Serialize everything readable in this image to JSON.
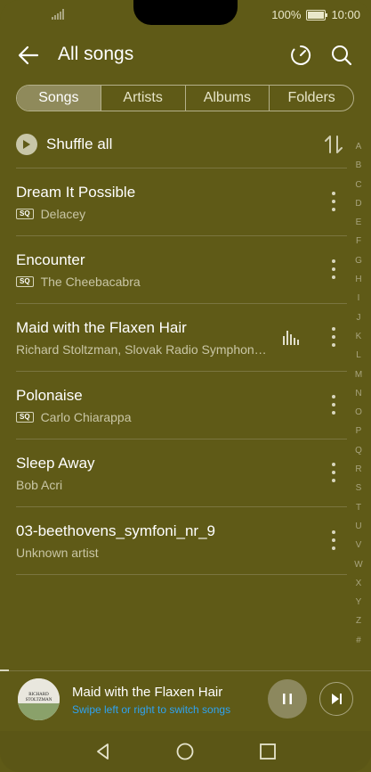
{
  "status": {
    "battery_text": "100%",
    "time": "10:00"
  },
  "header": {
    "title": "All songs",
    "icons": [
      "back-arrow-icon",
      "timer-icon",
      "search-icon"
    ]
  },
  "tabs": [
    {
      "label": "Songs",
      "active": true
    },
    {
      "label": "Artists",
      "active": false
    },
    {
      "label": "Albums",
      "active": false
    },
    {
      "label": "Folders",
      "active": false
    }
  ],
  "shuffle": {
    "label": "Shuffle all"
  },
  "songs": [
    {
      "title": "Dream It Possible",
      "artist": "Delacey",
      "sq": true,
      "playing": false
    },
    {
      "title": "Encounter",
      "artist": "The Cheebacabra",
      "sq": true,
      "playing": false
    },
    {
      "title": "Maid with the Flaxen Hair",
      "artist": "Richard Stoltzman, Slovak Radio Symphon…",
      "sq": false,
      "playing": true
    },
    {
      "title": "Polonaise",
      "artist": "Carlo Chiarappa",
      "sq": true,
      "playing": false
    },
    {
      "title": "Sleep Away",
      "artist": "Bob Acri",
      "sq": false,
      "playing": false
    },
    {
      "title": "03-beethovens_symfoni_nr_9",
      "artist": "Unknown artist",
      "sq": false,
      "playing": false
    }
  ],
  "sq_badge": "SQ",
  "alphabet": [
    "A",
    "B",
    "C",
    "D",
    "E",
    "F",
    "G",
    "H",
    "I",
    "J",
    "K",
    "L",
    "M",
    "N",
    "O",
    "P",
    "Q",
    "R",
    "S",
    "T",
    "U",
    "V",
    "W",
    "X",
    "Y",
    "Z",
    "#"
  ],
  "mini_player": {
    "title": "Maid with the Flaxen Hair",
    "hint": "Swipe left or right to switch songs",
    "cover_text_1": "RICHARD",
    "cover_text_2": "STOLTZMAN"
  },
  "colors": {
    "background": "#5f5a17",
    "accent_link": "#2ea3f2",
    "tab_active": "#8f8a5b"
  }
}
